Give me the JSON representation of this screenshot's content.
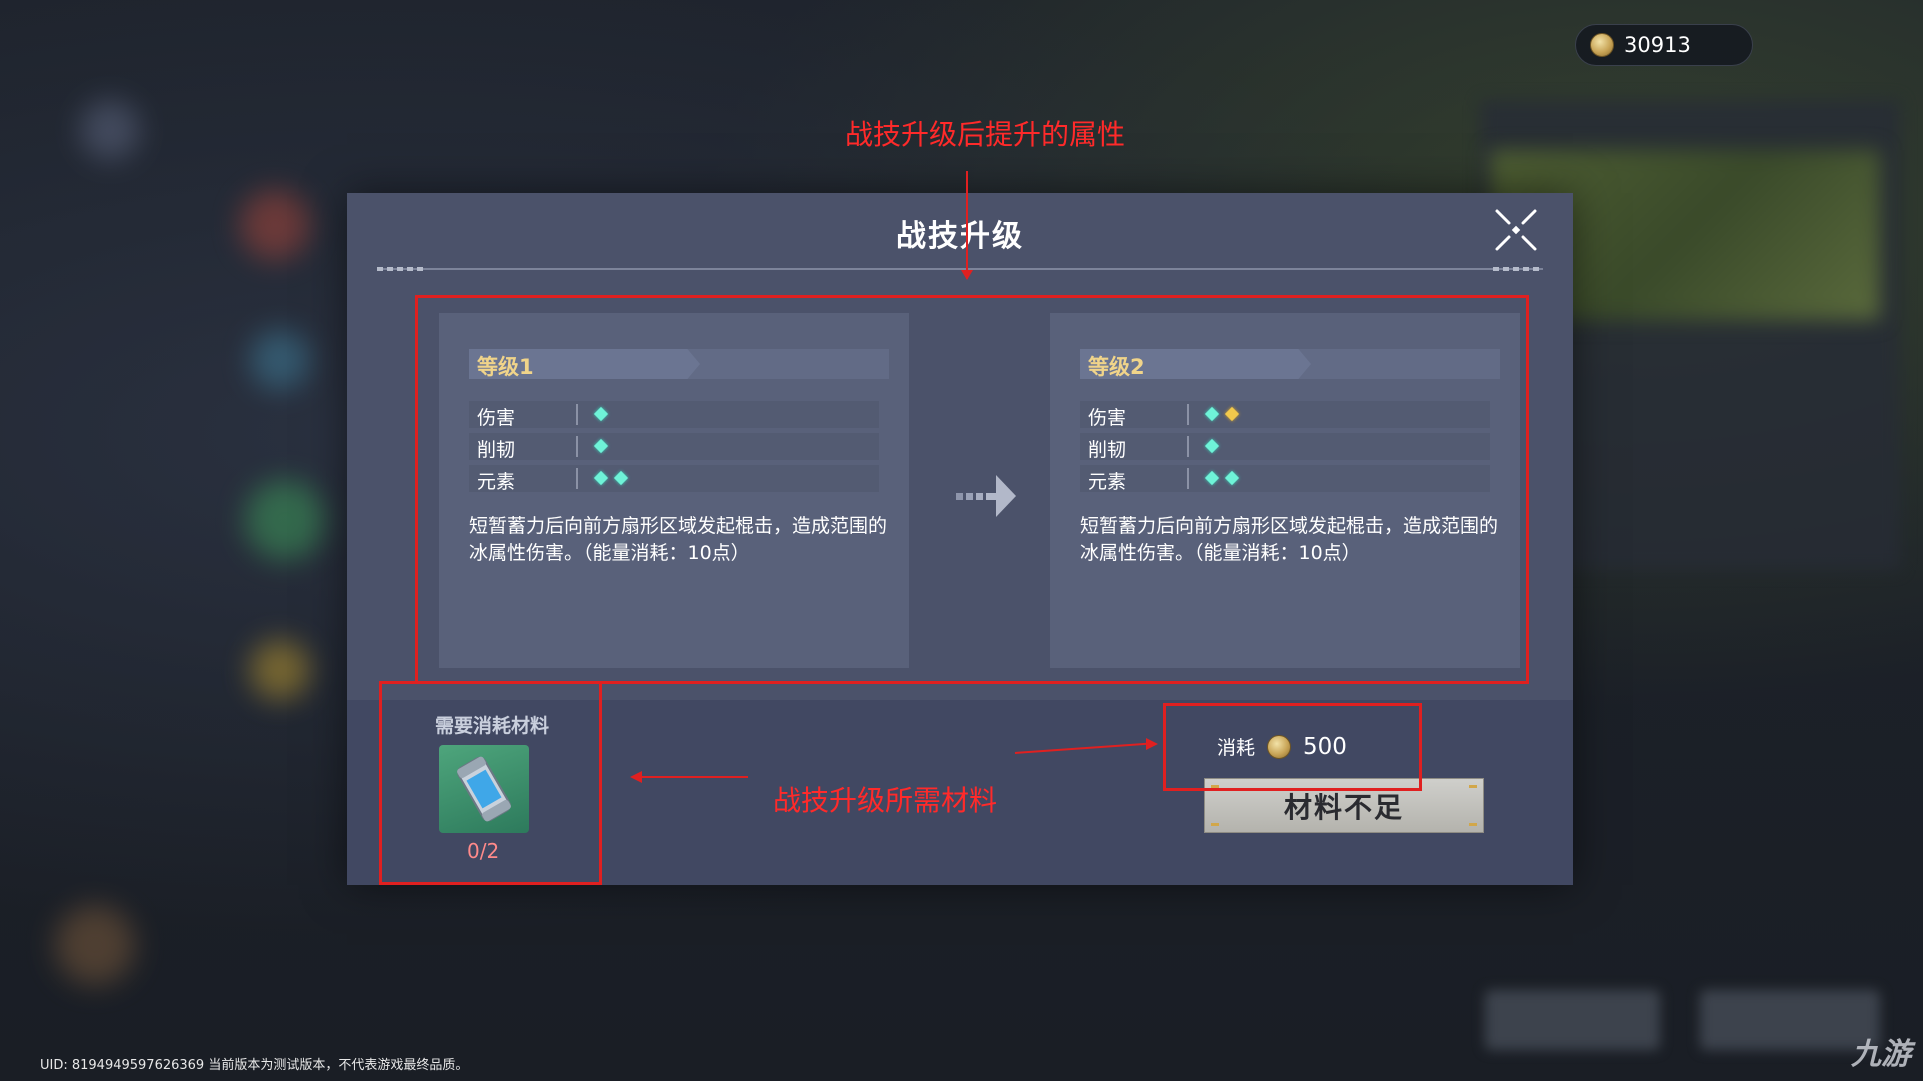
{
  "currency": {
    "amount": "30913"
  },
  "dialog": {
    "title": "战技升级",
    "from": {
      "level": "等级1",
      "attributes": [
        {
          "label": "伤害",
          "gems": [
            "cyan"
          ]
        },
        {
          "label": "削韧",
          "gems": [
            "cyan"
          ]
        },
        {
          "label": "元素",
          "gems": [
            "cyan",
            "cyan"
          ]
        }
      ],
      "description": "短暂蓄力后向前方扇形区域发起棍击，造成范围的冰属性伤害。（能量消耗：10点）"
    },
    "to": {
      "level": "等级2",
      "attributes": [
        {
          "label": "伤害",
          "gems": [
            "cyan",
            "gold"
          ]
        },
        {
          "label": "削韧",
          "gems": [
            "cyan"
          ]
        },
        {
          "label": "元素",
          "gems": [
            "cyan",
            "cyan"
          ]
        }
      ],
      "description": "短暂蓄力后向前方扇形区域发起棍击，造成范围的冰属性伤害。（能量消耗：10点）"
    },
    "materials": {
      "label": "需要消耗材料",
      "count": "0/2"
    },
    "cost": {
      "label": "消耗",
      "value": "500"
    },
    "action_button": "材料不足"
  },
  "annotations": {
    "attributes_note": "战技升级后提升的属性",
    "materials_note": "战技升级所需材料"
  },
  "footer": {
    "uid_text": "UID: 8194949597626369 当前版本为测试版本，不代表游戏最终品质。"
  },
  "watermark": "九游",
  "colors": {
    "gem_cyan": "#6ff3d8",
    "gem_gold": "#f2c94c",
    "level_gold": "#f0d48a",
    "annotation_red": "#e02020"
  }
}
